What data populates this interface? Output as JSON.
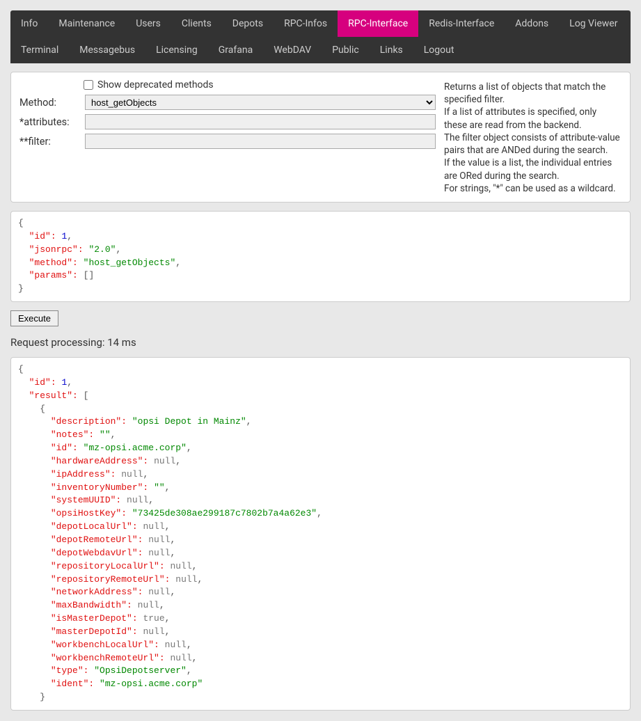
{
  "nav": {
    "items": [
      {
        "label": "Info"
      },
      {
        "label": "Maintenance"
      },
      {
        "label": "Users"
      },
      {
        "label": "Clients"
      },
      {
        "label": "Depots"
      },
      {
        "label": "RPC-Infos"
      },
      {
        "label": "RPC-Interface",
        "active": true
      },
      {
        "label": "Redis-Interface"
      },
      {
        "label": "Addons"
      },
      {
        "label": "Log Viewer"
      },
      {
        "label": "Terminal"
      },
      {
        "label": "Messagebus"
      },
      {
        "label": "Licensing"
      },
      {
        "label": "Grafana"
      },
      {
        "label": "WebDAV"
      },
      {
        "label": "Public"
      },
      {
        "label": "Links"
      },
      {
        "label": "Logout"
      }
    ]
  },
  "form": {
    "show_deprecated_label": "Show deprecated methods",
    "show_deprecated_checked": false,
    "method_label": "Method:",
    "method_value": "host_getObjects",
    "attributes_label": "*attributes:",
    "attributes_value": "",
    "filter_label": "**filter:",
    "filter_value": ""
  },
  "description": {
    "lines": [
      "Returns a list of objects that match the specified filter.",
      "If a list of attributes is specified, only these are read from the backend.",
      "The filter object consists of attribute-value pairs that are ANDed during the search.",
      "If the value is a list, the individual entries are ORed during the search.",
      "For strings, \"*\" can be used as a wildcard."
    ]
  },
  "request_json": {
    "id": 1,
    "jsonrpc": "2.0",
    "method": "host_getObjects",
    "params": []
  },
  "execute_label": "Execute",
  "processing_label": "Request processing: 14 ms",
  "response_json": {
    "id": 1,
    "result": [
      {
        "description": "opsi Depot in Mainz",
        "notes": "",
        "id": "mz-opsi.acme.corp",
        "hardwareAddress": null,
        "ipAddress": null,
        "inventoryNumber": "",
        "systemUUID": null,
        "opsiHostKey": "73425de308ae299187c7802b7a4a62e3",
        "depotLocalUrl": null,
        "depotRemoteUrl": null,
        "depotWebdavUrl": null,
        "repositoryLocalUrl": null,
        "repositoryRemoteUrl": null,
        "networkAddress": null,
        "maxBandwidth": null,
        "isMasterDepot": true,
        "masterDepotId": null,
        "workbenchLocalUrl": null,
        "workbenchRemoteUrl": null,
        "type": "OpsiDepotserver",
        "ident": "mz-opsi.acme.corp"
      }
    ]
  }
}
